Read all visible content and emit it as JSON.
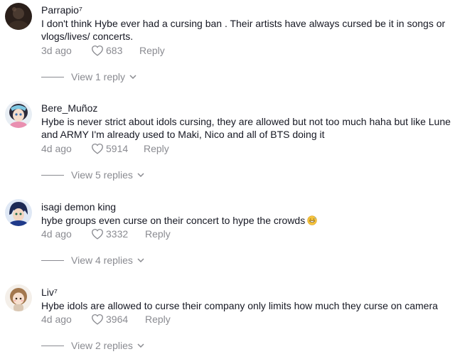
{
  "comments": [
    {
      "username": "Parrapio⁷",
      "text": "I don't think Hybe ever had a cursing ban . Their artists have always cursed be it in songs or vlogs/lives/ concerts.",
      "date": "3d ago",
      "likes": "683",
      "reply_label": "Reply",
      "view_replies": "View 1 reply",
      "avatar_icon": "dark-avatar"
    },
    {
      "username": "Bere_Muñoz",
      "text": "Hybe is never strict about idols cursing, they are allowed but not too much haha but like Lune and ARMY I'm already used to Maki, Nico and all of BTS doing it",
      "date": "4d ago",
      "likes": "5914",
      "reply_label": "Reply",
      "view_replies": "View 5 replies",
      "avatar_icon": "anime-girl-avatar"
    },
    {
      "username": "isagi demon king",
      "text": "hybe groups even curse on their concert to hype the crowds",
      "emoji": "grinning-sweat-emoji",
      "date": "4d ago",
      "likes": "3332",
      "reply_label": "Reply",
      "view_replies": "View 4 replies",
      "avatar_icon": "anime-boy-avatar"
    },
    {
      "username": "Liv⁷",
      "text": "Hybe idols are allowed to curse their company only limits how much they curse on camera",
      "date": "4d ago",
      "likes": "3964",
      "reply_label": "Reply",
      "view_replies": "View 2 replies",
      "avatar_icon": "cartoon-girl-avatar"
    }
  ],
  "colors": {
    "text_primary": "#161823",
    "text_secondary": "#8a8b91",
    "background": "#ffffff"
  }
}
